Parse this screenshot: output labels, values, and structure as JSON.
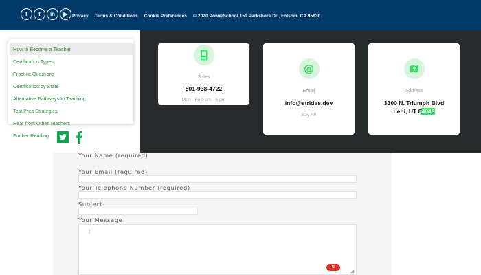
{
  "footer": {
    "social": [
      {
        "name": "twitter",
        "glyph": "t"
      },
      {
        "name": "facebook",
        "glyph": "f"
      },
      {
        "name": "linkedin",
        "glyph": "in"
      },
      {
        "name": "youtube",
        "glyph": "▶"
      }
    ],
    "links": [
      "Privacy",
      "Terms & Conditions",
      "Cookie Preferences"
    ],
    "copyright": "© 2020 PowerSchool 150 Parkshore Dr., Folsom, CA 95630"
  },
  "sidebar": {
    "items": [
      "How to Become a Teacher",
      "Certification Types",
      "Practice Questions",
      "Certification by State",
      "Alternative Pathways to Teaching",
      "Test Prep Strategies",
      "Hear from Other Teachers"
    ],
    "further_reading": "Further Reading",
    "share_icons": [
      "twitter-icon",
      "facebook-icon"
    ]
  },
  "contact": {
    "sales": {
      "label": "Sales",
      "value": "801-938-4722",
      "sub": "Mon - Fri 9 am - 5 pm"
    },
    "email": {
      "label": "Email",
      "value": "info@strides.dev",
      "sub": "Say Hi!"
    },
    "address": {
      "label": "Address",
      "line1": "3300 N. Triumph Blvd",
      "line2_pre": "Lehi, UT 8",
      "line2_hl": "4043"
    }
  },
  "form": {
    "name_label": "Your Name (required)",
    "email_label": "Your Email (required)",
    "phone_label": "Your Telephone Number (required)",
    "subject_label": "Subject",
    "message_label": "Your Message",
    "name_value": "",
    "email_value": "",
    "phone_value": "",
    "subject_value": "",
    "message_value": ""
  },
  "colors": {
    "header_bg": "#003a6b",
    "dark_bg": "#272b2c",
    "accent_green": "#2e8b3a",
    "icon_green": "#0aa84f",
    "highlight": "#2ee35f"
  }
}
